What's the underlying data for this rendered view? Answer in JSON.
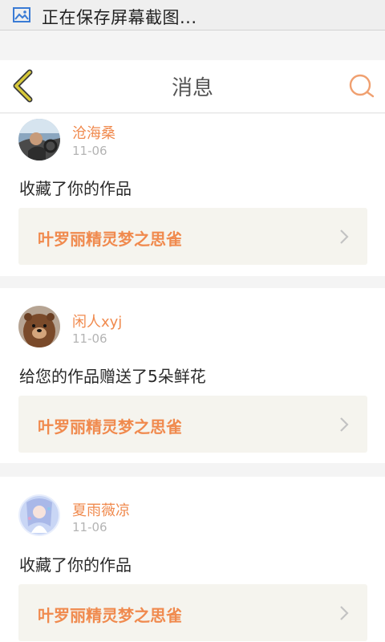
{
  "status_bar": {
    "icon": "image-icon",
    "text": "正在保存屏幕截图..."
  },
  "header": {
    "title": "消息",
    "back_icon": "chevron-left-icon",
    "search_icon": "search-icon",
    "accent_color": "#f08a4e",
    "back_color": "#c9b92a"
  },
  "messages": [
    {
      "user": "沧海桑",
      "time": "11-06",
      "action": "收藏了你的作品",
      "work": "叶罗丽精灵梦之思雀"
    },
    {
      "user": "闲人xyj",
      "time": "11-06",
      "action": "给您的作品赠送了5朵鲜花",
      "work": "叶罗丽精灵梦之思雀"
    },
    {
      "user": "夏雨薇凉",
      "time": "11-06",
      "action": "收藏了你的作品",
      "work": "叶罗丽精灵梦之思雀"
    }
  ]
}
